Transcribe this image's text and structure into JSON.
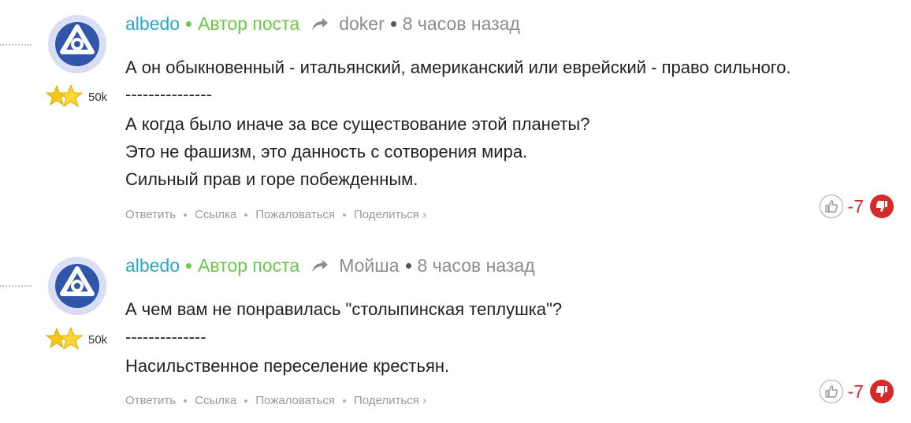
{
  "colors": {
    "author": "#2aa8c4",
    "op_badge": "#6cc84a",
    "muted": "#8c8c8c",
    "negative_score": "#d42a2a"
  },
  "comments": [
    {
      "author": "albedo",
      "op_badge": "Автор поста",
      "reply_to": "doker",
      "time": "8 часов назад",
      "karma": "50k",
      "lines": [
        "А он обыкновенный - итальянский, американский или еврейский - право сильного.",
        "---------------",
        "А когда было иначе за все существование этой планеты?",
        "Это не фашизм, это данность с сотворения мира.",
        "Сильный прав и горе побежденным."
      ],
      "actions": {
        "reply": "Ответить",
        "link": "Ссылка",
        "report": "Пожаловаться",
        "share": "Поделиться ›"
      },
      "score": "-7",
      "avatar_icon": "atom-logo-icon",
      "rating_icon": "stars-icon"
    },
    {
      "author": "albedo",
      "op_badge": "Автор поста",
      "reply_to": "Мойша",
      "time": "8 часов назад",
      "karma": "50k",
      "lines": [
        "А чем вам не понравилась \"столыпинская теплушка\"?",
        "--------------",
        "Насильственное переселение крестьян."
      ],
      "actions": {
        "reply": "Ответить",
        "link": "Ссылка",
        "report": "Пожаловаться",
        "share": "Поделиться ›"
      },
      "score": "-7",
      "avatar_icon": "atom-logo-icon",
      "rating_icon": "stars-icon"
    }
  ]
}
